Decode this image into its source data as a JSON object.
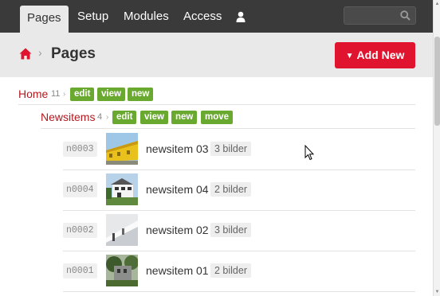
{
  "nav": {
    "tabs": [
      {
        "label": "Pages",
        "active": true
      },
      {
        "label": "Setup"
      },
      {
        "label": "Modules"
      },
      {
        "label": "Access"
      }
    ],
    "user_icon": "user-icon",
    "search_icon": "search-icon"
  },
  "header": {
    "home_icon": "home-icon",
    "separator": "›",
    "title": "Pages",
    "add_button": "Add New"
  },
  "tree": {
    "home": {
      "label": "Home",
      "count": "11",
      "actions": [
        "edit",
        "view",
        "new"
      ]
    },
    "newsitems": {
      "label": "Newsitems",
      "count": "4",
      "actions": [
        "edit",
        "view",
        "new",
        "move"
      ]
    },
    "items": [
      {
        "id": "n0003",
        "title": "newsitem 03",
        "badge": "3 bilder"
      },
      {
        "id": "n0004",
        "title": "newsitem 04",
        "badge": "2 bilder"
      },
      {
        "id": "n0002",
        "title": "newsitem 02",
        "badge": "3 bilder"
      },
      {
        "id": "n0001",
        "title": "newsitem 01",
        "badge": "2 bilder"
      }
    ]
  },
  "colors": {
    "nav_bg": "#3a3a3a",
    "accent_red": "#e0142f",
    "link_red": "#b01a1f",
    "action_green": "#6aa92f"
  }
}
